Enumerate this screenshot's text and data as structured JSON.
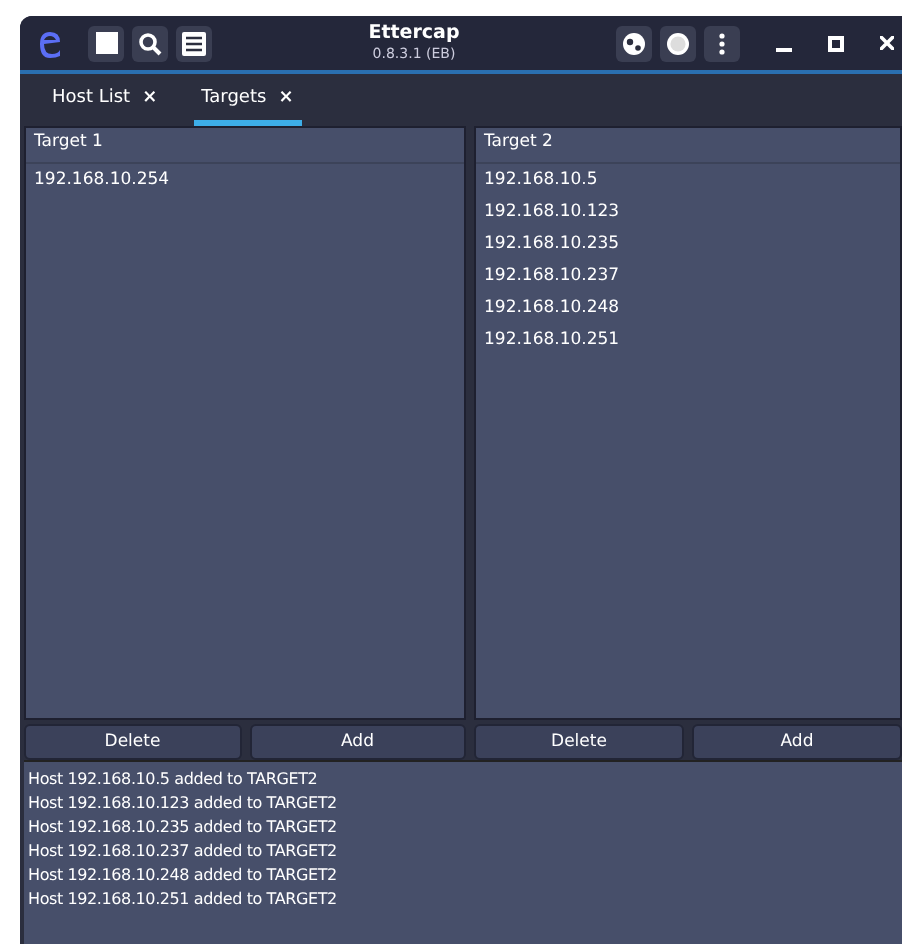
{
  "window": {
    "title": "Ettercap",
    "subtitle": "0.8.3.1 (EB)"
  },
  "tabs": [
    {
      "label": "Host List",
      "close": "×",
      "selected": false
    },
    {
      "label": "Targets",
      "close": "×",
      "selected": true
    }
  ],
  "targets": [
    {
      "title": "Target 1",
      "hosts": [
        "192.168.10.254"
      ],
      "buttons": [
        "Delete",
        "Add"
      ]
    },
    {
      "title": "Target 2",
      "hosts": [
        "192.168.10.5",
        "192.168.10.123",
        "192.168.10.235",
        "192.168.10.237",
        "192.168.10.248",
        "192.168.10.251"
      ],
      "buttons": [
        "Delete",
        "Add"
      ]
    }
  ],
  "log": [
    "Host 192.168.10.5 added to TARGET2",
    "Host 192.168.10.123 added to TARGET2",
    "Host 192.168.10.235 added to TARGET2",
    "Host 192.168.10.237 added to TARGET2",
    "Host 192.168.10.248 added to TARGET2",
    "Host 192.168.10.251 added to TARGET2"
  ]
}
